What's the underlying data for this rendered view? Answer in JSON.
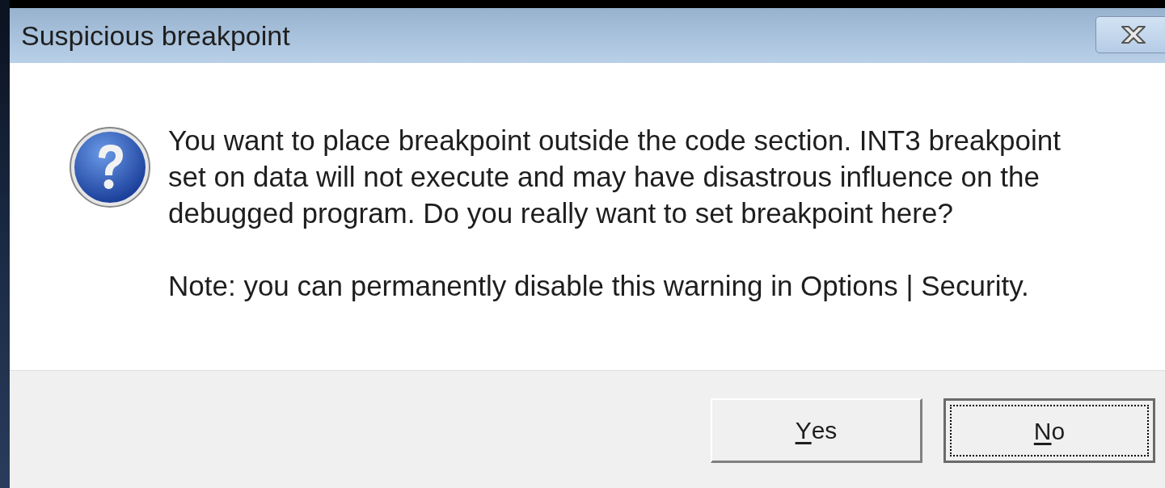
{
  "window": {
    "title": "Suspicious breakpoint"
  },
  "message": "You want to place breakpoint outside the code section. INT3 breakpoint set on data will not execute and may have disastrous influence on the debugged program. Do you really want to set breakpoint here?",
  "note": "Note: you can permanently disable this warning in Options | Security.",
  "buttons": [
    {
      "label": "Yes",
      "access_key_underlined": true,
      "focused": false
    },
    {
      "label": "No",
      "access_key_underlined": true,
      "focused": true
    }
  ]
}
